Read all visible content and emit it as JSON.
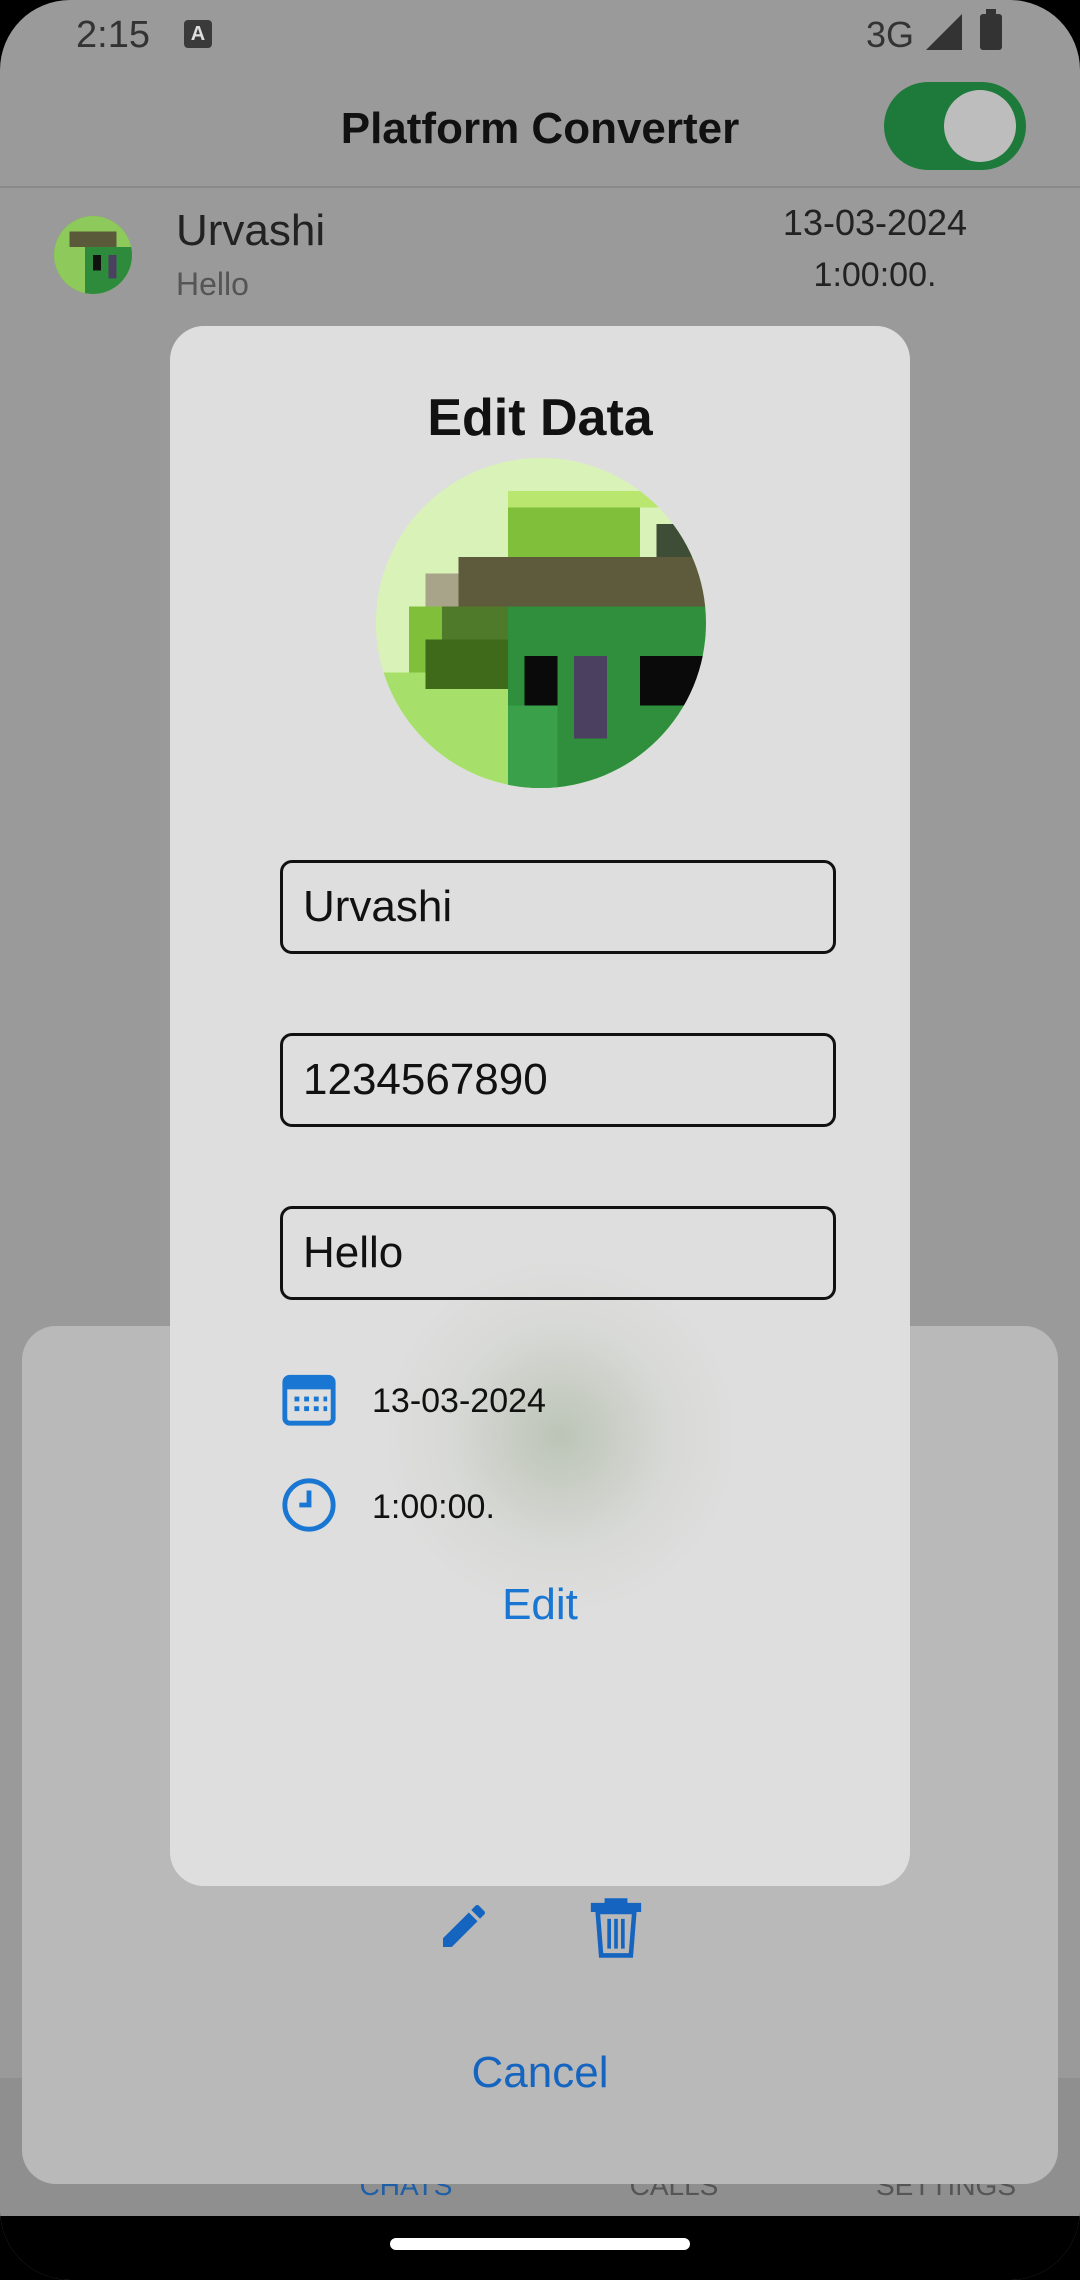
{
  "status_bar": {
    "time": "2:15",
    "network": "3G"
  },
  "app_bar": {
    "title": "Platform Converter",
    "toggle_on": true
  },
  "chat_item": {
    "name": "Urvashi",
    "message": "Hello",
    "date": "13-03-2024",
    "time": "1:00:00."
  },
  "bottom_nav": {
    "items": [
      "CHATS",
      "CALLS",
      "SETTINGS"
    ],
    "active": "CHATS"
  },
  "sheet": {
    "cancel_label": "Cancel"
  },
  "dialog": {
    "title": "Edit Data",
    "name_value": "Urvashi",
    "phone_value": "1234567890",
    "message_value": "Hello",
    "date": "13-03-2024",
    "time": "1:00:00.",
    "edit_label": "Edit"
  },
  "colors": {
    "accent": "#1976d2",
    "toggle": "#1e7a3a",
    "scrim": "#9a9a9a"
  },
  "icons": [
    "calendar-icon",
    "clock-icon",
    "pencil-icon",
    "trash-icon",
    "signal-icon",
    "battery-icon"
  ]
}
